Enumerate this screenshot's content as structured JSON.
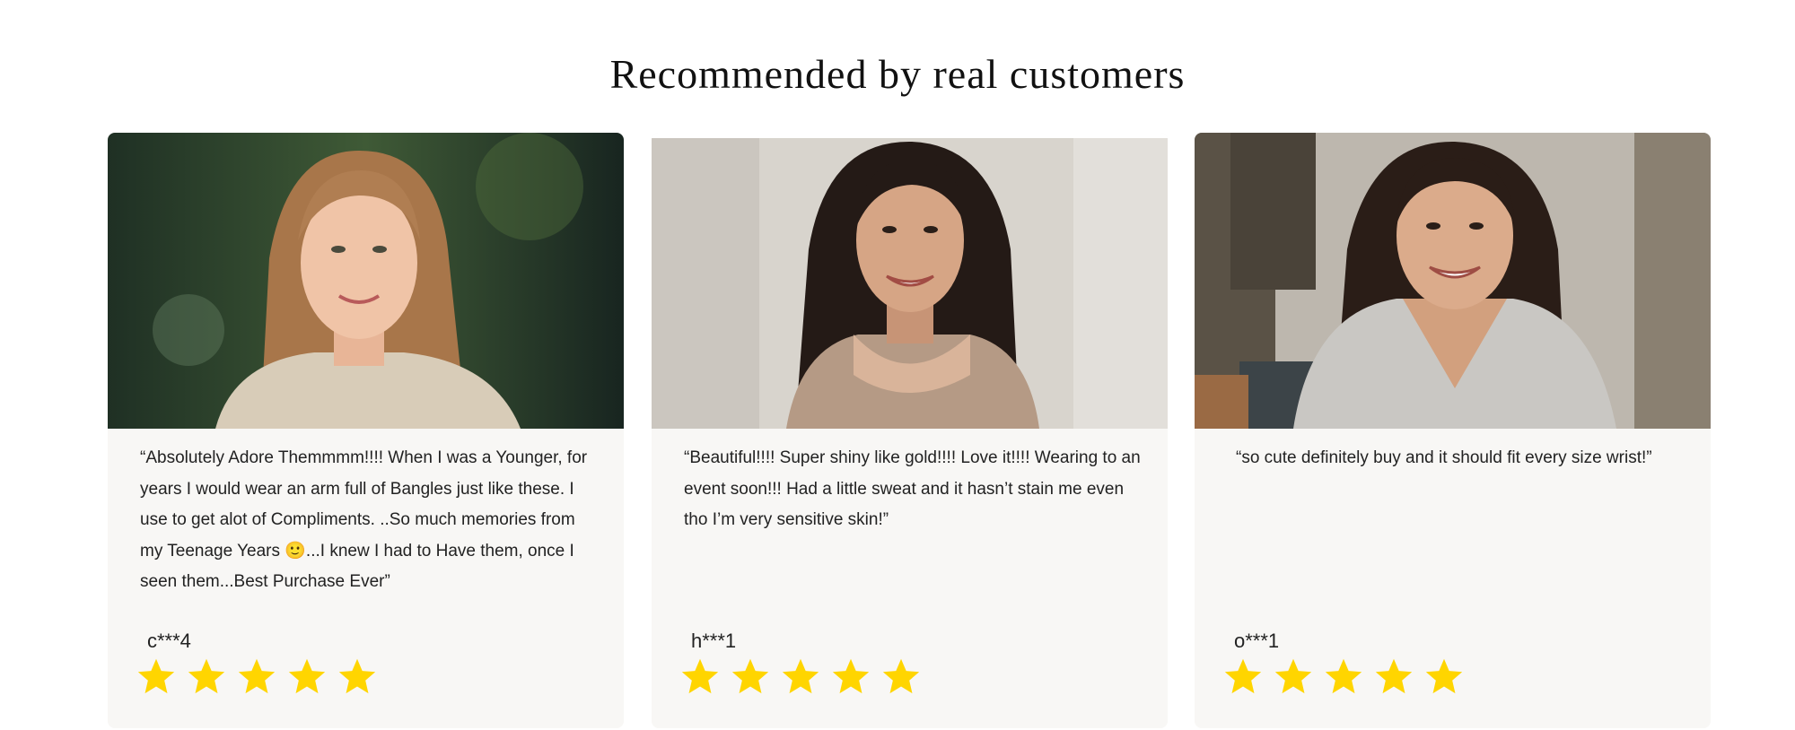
{
  "section": {
    "title": "Recommended by real customers"
  },
  "reviews": [
    {
      "quote": "“Absolutely Adore Themmmm!!!! When I was a Younger, for years I would wear an arm full of Bangles just like these. I use to get alot of Compliments. ..So much memories from my Teenage Years 🙂...I knew I had to Have them, once I seen them...Best Purchase Ever”",
      "user": "c***4",
      "rating": 5
    },
    {
      "quote": "“Beautiful!!!! Super shiny like gold!!!! Love it!!!! Wearing to an event soon!!! Had a little sweat and it hasn’t stain me even tho I’m very sensitive skin!”",
      "user": "h***1",
      "rating": 5
    },
    {
      "quote": "“so cute definitely buy and it should fit every size wrist!”",
      "user": "o***1",
      "rating": 5
    }
  ],
  "colors": {
    "star": "#ffd500",
    "card_bg": "#f8f7f5"
  }
}
